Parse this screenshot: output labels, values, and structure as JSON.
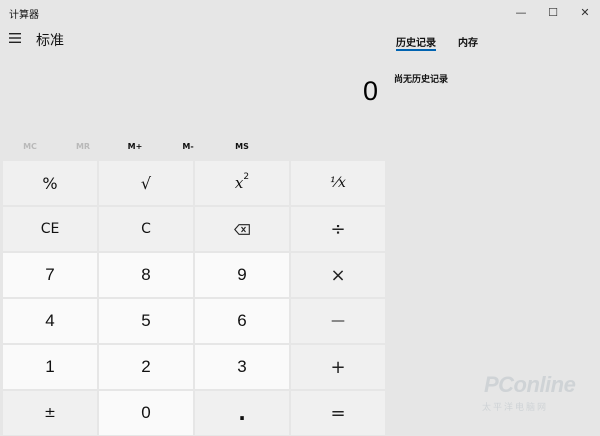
{
  "window": {
    "title": "计算器",
    "controls": {
      "minimize": "—",
      "maximize": "☐",
      "close": "✕"
    }
  },
  "header": {
    "menu_icon": "hamburger-menu-icon",
    "mode_title": "标准"
  },
  "display": {
    "value": "0"
  },
  "memory_buttons": [
    {
      "label": "MC",
      "enabled": false
    },
    {
      "label": "MR",
      "enabled": false
    },
    {
      "label": "M+",
      "enabled": true
    },
    {
      "label": "M-",
      "enabled": true
    },
    {
      "label": "MS",
      "enabled": true
    }
  ],
  "keys": {
    "percent": "%",
    "sqrt": "√",
    "square_base": "x",
    "square_exp": "2",
    "reciprocal": "⅟x",
    "ce": "CE",
    "c": "C",
    "backspace_icon": "backspace-icon",
    "divide": "÷",
    "n7": "7",
    "n8": "8",
    "n9": "9",
    "multiply": "×",
    "n4": "4",
    "n5": "5",
    "n6": "6",
    "minus": "—",
    "n1": "1",
    "n2": "2",
    "n3": "3",
    "plus": "+",
    "negate": "±",
    "n0": "0",
    "decimal": ".",
    "equals": "="
  },
  "side_panel": {
    "tabs": [
      {
        "label": "历史记录",
        "active": true
      },
      {
        "label": "内存",
        "active": false
      }
    ],
    "history_empty_text": "尚无历史记录"
  },
  "watermark": {
    "logo": "PConline",
    "sub": "太平洋电脑网"
  },
  "colors": {
    "background": "#e6e6e6",
    "key_function": "#f0f0f0",
    "key_number": "#fafafa",
    "accent_underline": "#0063b1"
  }
}
